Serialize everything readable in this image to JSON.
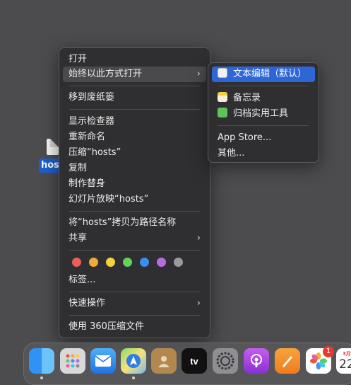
{
  "desktop": {
    "file_name": "hos"
  },
  "context_menu": {
    "open": "打开",
    "open_with": "始终以此方式打开",
    "move_to_trash": "移到废纸篓",
    "show_inspector": "显示检查器",
    "rename": "重新命名",
    "compress": "压缩“hosts”",
    "duplicate": "复制",
    "make_alias": "制作替身",
    "slideshow": "幻灯片放映“hosts”",
    "copy_path": "将“hosts”拷贝为路径名称",
    "share": "共享",
    "tags_label": "标签...",
    "quick_actions": "快速操作",
    "compress_360": "使用 360压缩文件",
    "tag_colors": [
      "#ec5f56",
      "#f2a93b",
      "#f3d23b",
      "#5fd35a",
      "#3a8ef0",
      "#b66ddf",
      "#9a9a9e"
    ],
    "arrow": "›"
  },
  "submenu": {
    "textedit": "文本编辑（默认）",
    "notes": "备忘录",
    "archive_utility": "归档实用工具",
    "app_store": "App Store...",
    "other": "其他..."
  },
  "dock": {
    "apple_tv_label": "tv",
    "photos_badge": "1",
    "calendar_day": "22",
    "calendar_month": "3月"
  }
}
